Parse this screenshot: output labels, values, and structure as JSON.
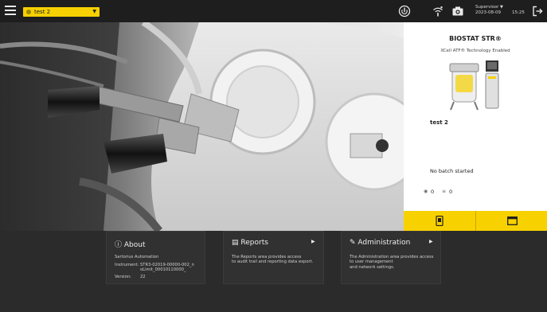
{
  "header": {
    "unit_name": "test 2",
    "user_role": "Supervisor",
    "date": "2023-08-09",
    "time": "15:25",
    "icons": [
      "menu-icon",
      "power-icon",
      "wifi-icon",
      "camera-icon",
      "logout-icon"
    ]
  },
  "side_panel": {
    "title": "BIOSTAT STR®",
    "subtitle": "XCell ATF® Technology Enabled",
    "unit_name": "test 2",
    "batch_status": "No batch started",
    "alarm_count": "0",
    "event_count": "0"
  },
  "about": {
    "title": "About",
    "company": "Sartorius Automation",
    "instrument_label": "Instrument:",
    "instrument_value_line1": "STR3-02019-00000-002_n",
    "instrument_value_line2": "oLimit_00010110000_",
    "version_label": "Version:",
    "version_value": "22"
  },
  "reports": {
    "title": "Reports",
    "desc_line1": "The Reports area provides access",
    "desc_line2": "to audit trail and reporting data export."
  },
  "administration": {
    "title": "Administration",
    "desc_line1": "The Administration area provides access",
    "desc_line2": "to user management",
    "desc_line3": "and network settings."
  },
  "colors": {
    "accent": "#f8d200",
    "topbar": "#1e1e1e",
    "panel": "#313131"
  }
}
